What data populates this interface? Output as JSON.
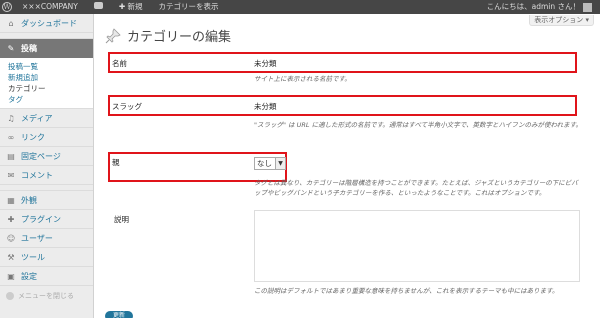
{
  "adminbar": {
    "site": "×××COMPANY",
    "comments_icon": "comment-bubble-icon",
    "new": "✚ 新規",
    "view_category": "カテゴリーを表示",
    "greeting": "こんにちは、admin さん！"
  },
  "sidebar": {
    "dashboard": "ダッシュボード",
    "posts": "投稿",
    "post_sub": [
      "投稿一覧",
      "新規追加",
      "カテゴリー",
      "タグ"
    ],
    "media": "メディア",
    "links": "リンク",
    "pages": "固定ページ",
    "comments": "コメント",
    "appearance": "外観",
    "plugins": "プラグイン",
    "users": "ユーザー",
    "tools": "ツール",
    "settings": "設定",
    "collapse": "メニューを閉じる"
  },
  "main": {
    "screen_options": "表示オプション ▾",
    "title": "カテゴリーの編集",
    "name_label": "名前",
    "name_value": "未分類",
    "name_desc": "サイト上に表示される名前です。",
    "slug_label": "スラッグ",
    "slug_value": "未分類",
    "slug_desc": "\"スラッグ\" は URL に適した形式の名前です。通常はすべて半角小文字で、英数字とハイフンのみが使われます。",
    "parent_label": "親",
    "parent_value": "なし",
    "parent_desc": "タグとは異なり、カテゴリーは階層構造を持つことができます。たとえば、ジャズというカテゴリーの下にビバップやビッグバンドという子カテゴリーを作る、といったようなことです。これはオプションです。",
    "description_label": "説明",
    "description_desc": "この説明はデフォルトではあまり重要な意味を持ちませんが、これを表示するテーマも中にはあります。",
    "update_button": "更新"
  }
}
